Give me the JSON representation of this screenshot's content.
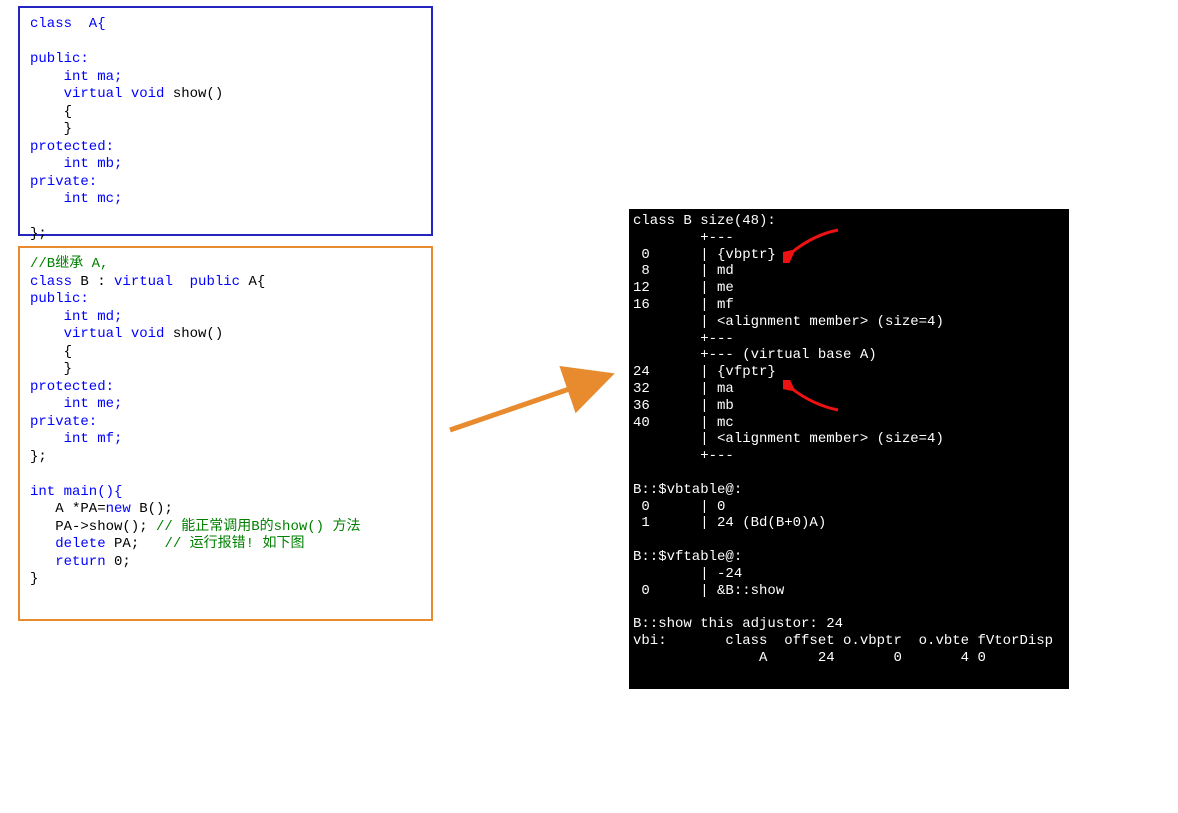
{
  "classA": {
    "l1": "class  A{",
    "l2": "",
    "l3": "public:",
    "l4": "    int ma;",
    "l5a": "    virtual void",
    "l5b": " show()",
    "l6": "    {",
    "l7": "    }",
    "l8": "protected:",
    "l9": "    int mb;",
    "l10": "private:",
    "l11": "    int mc;",
    "l12": "",
    "l13": "};"
  },
  "classB": {
    "c1": "//B继承 A,",
    "l1a": "class",
    "l1b": " B : ",
    "l1c": "virtual  public",
    "l1d": " A{",
    "l2": "public:",
    "l3": "    int md;",
    "l4a": "    virtual void",
    "l4b": " show()",
    "l5": "    {",
    "l6": "    }",
    "l7": "protected:",
    "l8": "    int me;",
    "l9": "private:",
    "l10": "    int mf;",
    "l11": "};",
    "l12": "",
    "m1": "int main(){",
    "m2a": "   A *PA=",
    "m2b": "new",
    "m2c": " B();",
    "m3a": "   PA->show(); ",
    "m3c": "// 能正常调用B的show() 方法",
    "m4a": "   delete",
    "m4b": " PA;   ",
    "m4c": "// 运行报错! 如下图",
    "m5a": "   return",
    "m5b": " 0;",
    "m6": "}"
  },
  "console": {
    "l1": "class B size(48):",
    "l2": "        +---",
    "l3": " 0      | {vbptr}",
    "l4": " 8      | md",
    "l5": "12      | me",
    "l6": "16      | mf",
    "l7": "        | <alignment member> (size=4)",
    "l8": "        +---",
    "l9": "        +--- (virtual base A)",
    "l10": "24      | {vfptr}",
    "l11": "32      | ma",
    "l12": "36      | mb",
    "l13": "40      | mc",
    "l14": "        | <alignment member> (size=4)",
    "l15": "        +---",
    "l16": "",
    "l17": "B::$vbtable@:",
    "l18": " 0      | 0",
    "l19": " 1      | 24 (Bd(B+0)A)",
    "l20": "",
    "l21": "B::$vftable@:",
    "l22": "        | -24",
    "l23": " 0      | &B::show",
    "l24": "",
    "l25": "B::show this adjustor: 24",
    "l26": "vbi:       class  offset o.vbptr  o.vbte fVtorDisp",
    "l27": "               A      24       0       4 0"
  }
}
